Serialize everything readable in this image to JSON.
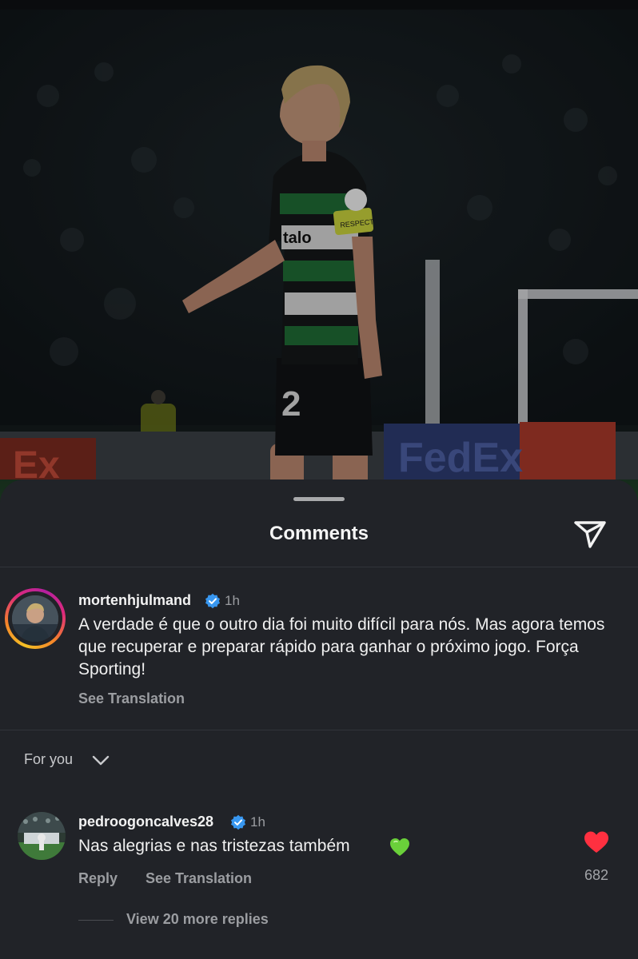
{
  "photo": {
    "description_icon": "football-player-photo",
    "shirt_sponsor": "talo",
    "shirt_number": "2",
    "board_text": "FedEx",
    "captain_band": "RESPECT"
  },
  "sheet": {
    "title": "Comments",
    "share_icon": "paper-plane-icon"
  },
  "post": {
    "username": "mortenhjulmand",
    "verified_icon": "verified-badge-icon",
    "time": "1h",
    "caption": "A verdade é que o outro dia foi muito difícil para nós. Mas agora temos que recuperar e preparar rápido para ganhar o próximo jogo. Força Sporting!",
    "see_translation": "See Translation"
  },
  "filter": {
    "label": "For you",
    "icon": "chevron-down-icon"
  },
  "comment": {
    "username": "pedroogoncalves28",
    "verified_icon": "verified-badge-icon",
    "time": "1h",
    "text": "Nas alegrias e nas tristezas também",
    "emoji_icon": "green-heart-icon",
    "reply_label": "Reply",
    "see_translation": "See Translation",
    "like_icon": "heart-filled-icon",
    "like_count": "682",
    "view_replies": "View 20 more replies"
  },
  "colors": {
    "sheet_bg": "#212328",
    "verified": "#3897f0",
    "like_red": "#ff3040",
    "green_heart": "#6ad03a",
    "secondary_text": "#9b9da1"
  }
}
